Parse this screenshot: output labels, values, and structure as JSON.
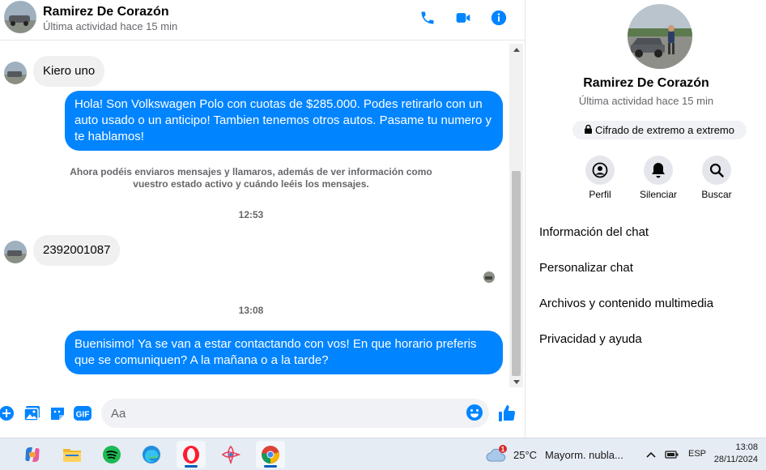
{
  "contact": {
    "name": "Ramirez De Corazón",
    "status": "Última actividad hace 15 min"
  },
  "header": {
    "call_icon": "phone-icon",
    "video_icon": "video-camera-icon",
    "info_icon": "info-icon"
  },
  "messages": [
    {
      "type": "incoming",
      "text": "Kiero uno"
    },
    {
      "type": "outgoing",
      "text": "Hola! Son Volkswagen Polo con cuotas de $285.000. Podes retirarlo con un auto usado o un anticipo! Tambien tenemos otros autos. Pasame tu numero y te hablamos!"
    },
    {
      "type": "system",
      "text": "Ahora podéis enviaros mensajes y llamaros, además de ver información como vuestro estado activo y cuándo leéis los mensajes."
    },
    {
      "type": "time",
      "text": "12:53"
    },
    {
      "type": "incoming",
      "text": "2392001087"
    },
    {
      "type": "time",
      "text": "13:08"
    },
    {
      "type": "outgoing",
      "text": "Buenisimo! Ya se van a estar contactando con vos! En que horario preferis que se comuniquen? A la mañana o a la tarde?"
    }
  ],
  "composer": {
    "placeholder": "Aa",
    "icons": [
      "plus-icon",
      "image-icon",
      "sticker-icon",
      "gif-icon",
      "emoji-icon",
      "thumbs-up-icon"
    ],
    "gif_label": "GIF"
  },
  "panel": {
    "name": "Ramirez De Corazón",
    "status": "Última actividad hace 15 min",
    "encryption": "Cifrado de extremo a extremo",
    "actions": [
      {
        "label": "Perfil",
        "icon": "profile-icon"
      },
      {
        "label": "Silenciar",
        "icon": "bell-icon"
      },
      {
        "label": "Buscar",
        "icon": "search-icon"
      }
    ],
    "menu": [
      "Información del chat",
      "Personalizar chat",
      "Archivos y contenido multimedia",
      "Privacidad y ayuda"
    ]
  },
  "taskbar": {
    "apps": [
      "copilot-icon",
      "file-explorer-icon",
      "spotify-icon",
      "edge-icon",
      "opera-icon",
      "app-icon",
      "chrome-icon"
    ],
    "weather_badge": "1",
    "temperature": "25°C",
    "weather_text": "Mayorm. nubla...",
    "language": "ESP",
    "time": "13:08",
    "date": "28/11/2024"
  },
  "colors": {
    "accent": "#0084ff",
    "bubble_in": "#f0f0f0",
    "muted_text": "#65676b"
  }
}
